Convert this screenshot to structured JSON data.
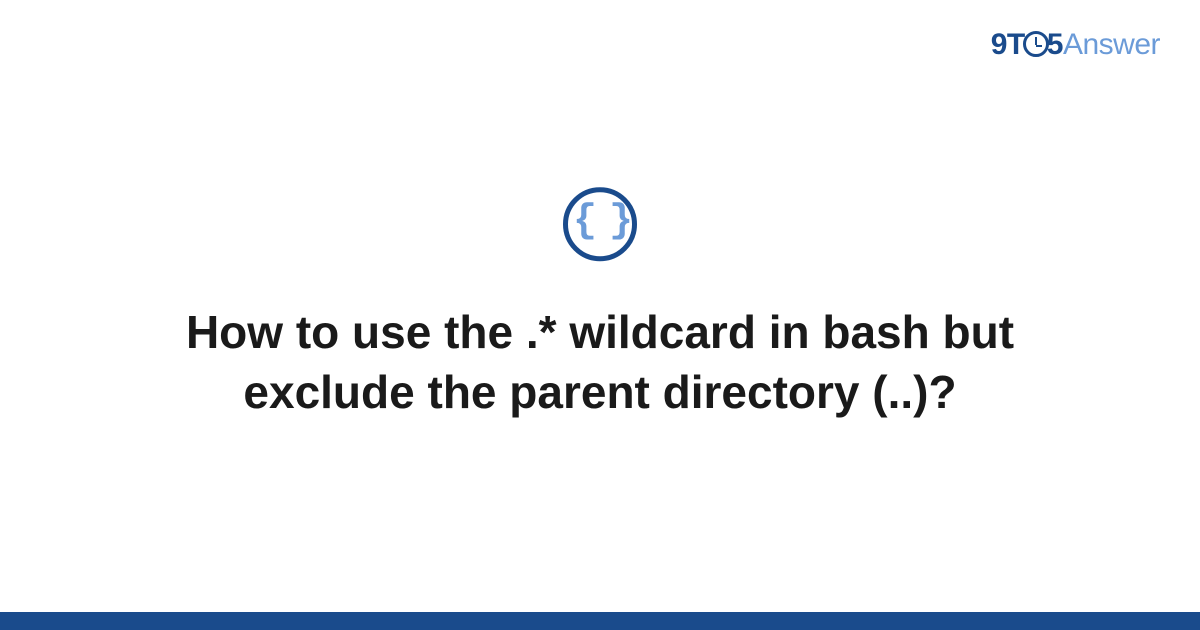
{
  "logo": {
    "part1": "9T",
    "part2": "5",
    "part3": "Answer"
  },
  "icon": {
    "braces": "{ }"
  },
  "question": {
    "title": "How to use the .* wildcard in bash but exclude the parent directory (..)?"
  },
  "colors": {
    "primary": "#1a4b8c",
    "secondary": "#6b9bd8",
    "text": "#1a1a1a"
  }
}
